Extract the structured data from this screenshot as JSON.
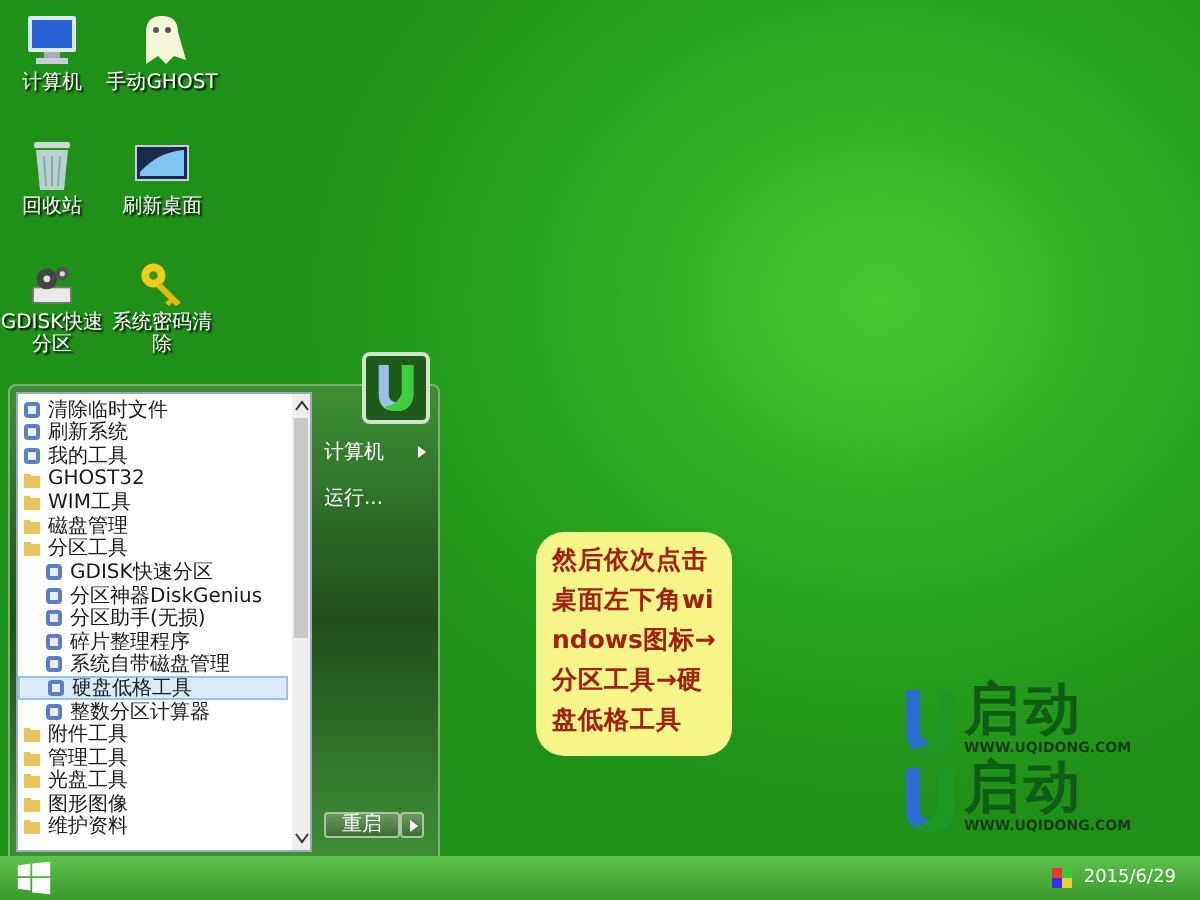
{
  "desktop_icons": [
    {
      "label": "计算机",
      "kind": "computer"
    },
    {
      "label": "手动GHOST",
      "kind": "ghost"
    },
    {
      "label": "回收站",
      "kind": "bin"
    },
    {
      "label": "刷新桌面",
      "kind": "screen"
    },
    {
      "label": "GDISK快速分区",
      "kind": "gears"
    },
    {
      "label": "系统密码清除",
      "kind": "key"
    }
  ],
  "start_menu": {
    "programs": [
      {
        "label": "清除临时文件",
        "kind": "program",
        "selected": false
      },
      {
        "label": "刷新系统",
        "kind": "program",
        "selected": false
      },
      {
        "label": "我的工具",
        "kind": "program",
        "selected": false
      },
      {
        "label": "GHOST32",
        "kind": "folder",
        "selected": false
      },
      {
        "label": "WIM工具",
        "kind": "folder",
        "selected": false
      },
      {
        "label": "磁盘管理",
        "kind": "folder",
        "selected": false
      },
      {
        "label": "分区工具",
        "kind": "folder",
        "expanded": true,
        "selected": false,
        "children": [
          {
            "label": "GDISK快速分区",
            "kind": "program",
            "selected": false
          },
          {
            "label": "分区神器DiskGenius",
            "kind": "program",
            "selected": false
          },
          {
            "label": "分区助手(无损)",
            "kind": "program",
            "selected": false
          },
          {
            "label": "碎片整理程序",
            "kind": "program",
            "selected": false
          },
          {
            "label": "系统自带磁盘管理",
            "kind": "program",
            "selected": false
          },
          {
            "label": "硬盘低格工具",
            "kind": "program",
            "selected": true
          },
          {
            "label": "整数分区计算器",
            "kind": "program",
            "selected": false
          }
        ]
      },
      {
        "label": "附件工具",
        "kind": "folder",
        "selected": false
      },
      {
        "label": "管理工具",
        "kind": "folder",
        "selected": false
      },
      {
        "label": "光盘工具",
        "kind": "folder",
        "selected": false
      },
      {
        "label": "图形图像",
        "kind": "folder",
        "selected": false
      },
      {
        "label": "维护资料",
        "kind": "folder",
        "selected": false
      }
    ],
    "places": [
      {
        "label": "计算机",
        "submenu": true
      },
      {
        "label": "运行...",
        "submenu": false
      }
    ],
    "power_button": {
      "label": "重启"
    }
  },
  "callout": {
    "text": "然后依次点击桌面左下角windows图标→分区工具→硬盘低格工具"
  },
  "logos": [
    {
      "name": "启动",
      "url": "WWW.UQIDONG.COM"
    },
    {
      "name": "启动",
      "url": "WWW.UQIDONG.COM"
    }
  ],
  "taskbar": {
    "clock": "2015/6/29"
  }
}
